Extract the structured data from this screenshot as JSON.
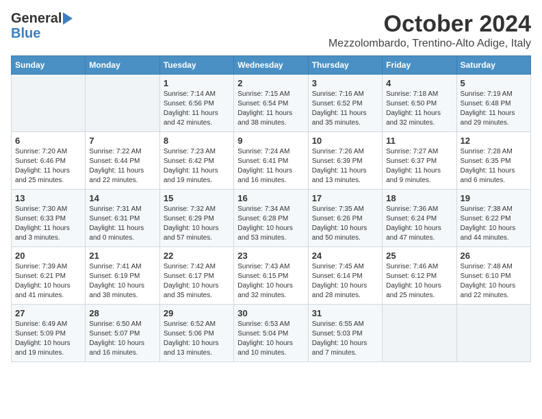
{
  "logo": {
    "general": "General",
    "blue": "Blue"
  },
  "header": {
    "month": "October 2024",
    "location": "Mezzolombardo, Trentino-Alto Adige, Italy"
  },
  "weekdays": [
    "Sunday",
    "Monday",
    "Tuesday",
    "Wednesday",
    "Thursday",
    "Friday",
    "Saturday"
  ],
  "weeks": [
    [
      {
        "day": null
      },
      {
        "day": null
      },
      {
        "day": "1",
        "sunrise": "Sunrise: 7:14 AM",
        "sunset": "Sunset: 6:56 PM",
        "daylight": "Daylight: 11 hours and 42 minutes."
      },
      {
        "day": "2",
        "sunrise": "Sunrise: 7:15 AM",
        "sunset": "Sunset: 6:54 PM",
        "daylight": "Daylight: 11 hours and 38 minutes."
      },
      {
        "day": "3",
        "sunrise": "Sunrise: 7:16 AM",
        "sunset": "Sunset: 6:52 PM",
        "daylight": "Daylight: 11 hours and 35 minutes."
      },
      {
        "day": "4",
        "sunrise": "Sunrise: 7:18 AM",
        "sunset": "Sunset: 6:50 PM",
        "daylight": "Daylight: 11 hours and 32 minutes."
      },
      {
        "day": "5",
        "sunrise": "Sunrise: 7:19 AM",
        "sunset": "Sunset: 6:48 PM",
        "daylight": "Daylight: 11 hours and 29 minutes."
      }
    ],
    [
      {
        "day": "6",
        "sunrise": "Sunrise: 7:20 AM",
        "sunset": "Sunset: 6:46 PM",
        "daylight": "Daylight: 11 hours and 25 minutes."
      },
      {
        "day": "7",
        "sunrise": "Sunrise: 7:22 AM",
        "sunset": "Sunset: 6:44 PM",
        "daylight": "Daylight: 11 hours and 22 minutes."
      },
      {
        "day": "8",
        "sunrise": "Sunrise: 7:23 AM",
        "sunset": "Sunset: 6:42 PM",
        "daylight": "Daylight: 11 hours and 19 minutes."
      },
      {
        "day": "9",
        "sunrise": "Sunrise: 7:24 AM",
        "sunset": "Sunset: 6:41 PM",
        "daylight": "Daylight: 11 hours and 16 minutes."
      },
      {
        "day": "10",
        "sunrise": "Sunrise: 7:26 AM",
        "sunset": "Sunset: 6:39 PM",
        "daylight": "Daylight: 11 hours and 13 minutes."
      },
      {
        "day": "11",
        "sunrise": "Sunrise: 7:27 AM",
        "sunset": "Sunset: 6:37 PM",
        "daylight": "Daylight: 11 hours and 9 minutes."
      },
      {
        "day": "12",
        "sunrise": "Sunrise: 7:28 AM",
        "sunset": "Sunset: 6:35 PM",
        "daylight": "Daylight: 11 hours and 6 minutes."
      }
    ],
    [
      {
        "day": "13",
        "sunrise": "Sunrise: 7:30 AM",
        "sunset": "Sunset: 6:33 PM",
        "daylight": "Daylight: 11 hours and 3 minutes."
      },
      {
        "day": "14",
        "sunrise": "Sunrise: 7:31 AM",
        "sunset": "Sunset: 6:31 PM",
        "daylight": "Daylight: 11 hours and 0 minutes."
      },
      {
        "day": "15",
        "sunrise": "Sunrise: 7:32 AM",
        "sunset": "Sunset: 6:29 PM",
        "daylight": "Daylight: 10 hours and 57 minutes."
      },
      {
        "day": "16",
        "sunrise": "Sunrise: 7:34 AM",
        "sunset": "Sunset: 6:28 PM",
        "daylight": "Daylight: 10 hours and 53 minutes."
      },
      {
        "day": "17",
        "sunrise": "Sunrise: 7:35 AM",
        "sunset": "Sunset: 6:26 PM",
        "daylight": "Daylight: 10 hours and 50 minutes."
      },
      {
        "day": "18",
        "sunrise": "Sunrise: 7:36 AM",
        "sunset": "Sunset: 6:24 PM",
        "daylight": "Daylight: 10 hours and 47 minutes."
      },
      {
        "day": "19",
        "sunrise": "Sunrise: 7:38 AM",
        "sunset": "Sunset: 6:22 PM",
        "daylight": "Daylight: 10 hours and 44 minutes."
      }
    ],
    [
      {
        "day": "20",
        "sunrise": "Sunrise: 7:39 AM",
        "sunset": "Sunset: 6:21 PM",
        "daylight": "Daylight: 10 hours and 41 minutes."
      },
      {
        "day": "21",
        "sunrise": "Sunrise: 7:41 AM",
        "sunset": "Sunset: 6:19 PM",
        "daylight": "Daylight: 10 hours and 38 minutes."
      },
      {
        "day": "22",
        "sunrise": "Sunrise: 7:42 AM",
        "sunset": "Sunset: 6:17 PM",
        "daylight": "Daylight: 10 hours and 35 minutes."
      },
      {
        "day": "23",
        "sunrise": "Sunrise: 7:43 AM",
        "sunset": "Sunset: 6:15 PM",
        "daylight": "Daylight: 10 hours and 32 minutes."
      },
      {
        "day": "24",
        "sunrise": "Sunrise: 7:45 AM",
        "sunset": "Sunset: 6:14 PM",
        "daylight": "Daylight: 10 hours and 28 minutes."
      },
      {
        "day": "25",
        "sunrise": "Sunrise: 7:46 AM",
        "sunset": "Sunset: 6:12 PM",
        "daylight": "Daylight: 10 hours and 25 minutes."
      },
      {
        "day": "26",
        "sunrise": "Sunrise: 7:48 AM",
        "sunset": "Sunset: 6:10 PM",
        "daylight": "Daylight: 10 hours and 22 minutes."
      }
    ],
    [
      {
        "day": "27",
        "sunrise": "Sunrise: 6:49 AM",
        "sunset": "Sunset: 5:09 PM",
        "daylight": "Daylight: 10 hours and 19 minutes."
      },
      {
        "day": "28",
        "sunrise": "Sunrise: 6:50 AM",
        "sunset": "Sunset: 5:07 PM",
        "daylight": "Daylight: 10 hours and 16 minutes."
      },
      {
        "day": "29",
        "sunrise": "Sunrise: 6:52 AM",
        "sunset": "Sunset: 5:06 PM",
        "daylight": "Daylight: 10 hours and 13 minutes."
      },
      {
        "day": "30",
        "sunrise": "Sunrise: 6:53 AM",
        "sunset": "Sunset: 5:04 PM",
        "daylight": "Daylight: 10 hours and 10 minutes."
      },
      {
        "day": "31",
        "sunrise": "Sunrise: 6:55 AM",
        "sunset": "Sunset: 5:03 PM",
        "daylight": "Daylight: 10 hours and 7 minutes."
      },
      {
        "day": null
      },
      {
        "day": null
      }
    ]
  ]
}
